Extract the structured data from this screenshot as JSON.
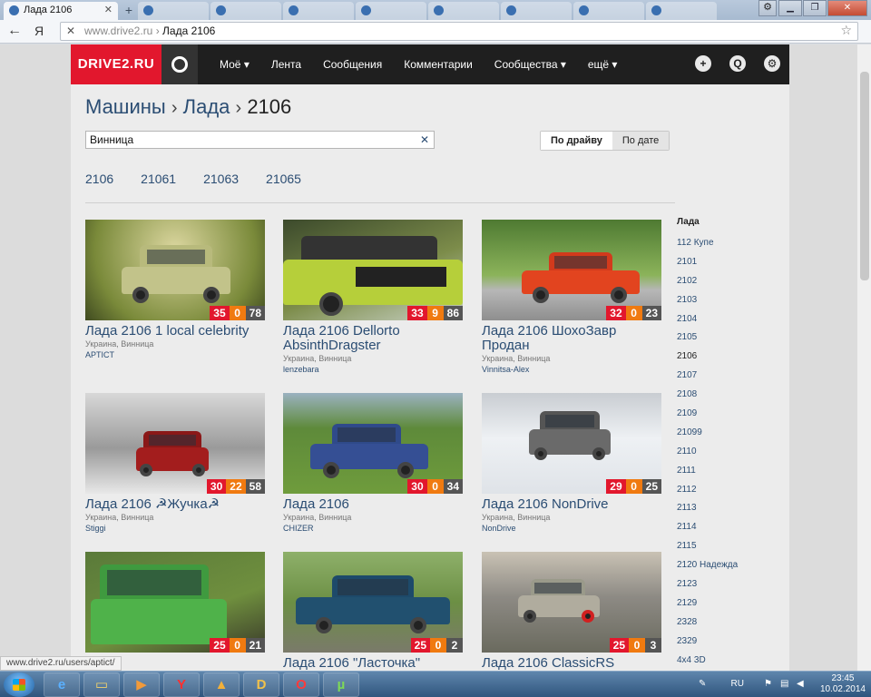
{
  "browser": {
    "tab_title": "Лада 2106",
    "url_host": "www.drive2.ru",
    "url_sep": "›",
    "url_page": "Лада 2106"
  },
  "site": {
    "logo": "DRIVE2.RU",
    "nav": [
      {
        "label": "Моё ▾"
      },
      {
        "label": "Лента"
      },
      {
        "label": "Сообщения"
      },
      {
        "label": "Комментарии"
      },
      {
        "label": "Сообщества ▾"
      },
      {
        "label": "ещё ▾"
      }
    ],
    "breadcrumb": {
      "part1": "Машины",
      "part2": "Лада",
      "current": "2106",
      "sep": "›"
    },
    "search_value": "Винница",
    "sort": {
      "by_drive": "По драйву",
      "by_date": "По дате"
    },
    "models": [
      "2106",
      "21061",
      "21063",
      "21065"
    ]
  },
  "cards": [
    {
      "title": "Лада 2106 1 local celebrity",
      "location": "Украина, Винница",
      "user": "APTICT",
      "s1": "35",
      "s2": "0",
      "s3": "78"
    },
    {
      "title": "Лада 2106 Dellorto AbsinthDragster",
      "location": "Украина, Винница",
      "user": "lenzebara",
      "s1": "33",
      "s2": "9",
      "s3": "86"
    },
    {
      "title": "Лада 2106 ШохоЗавр Продан",
      "location": "Украина, Винница",
      "user": "Vinnitsa-Alex",
      "s1": "32",
      "s2": "0",
      "s3": "23"
    },
    {
      "title": "Лада 2106 ☭Жучка☭",
      "location": "Украина, Винница",
      "user": "Stiggi",
      "s1": "30",
      "s2": "22",
      "s3": "58"
    },
    {
      "title": "Лада 2106",
      "location": "Украина, Винница",
      "user": "CHIZER",
      "s1": "30",
      "s2": "0",
      "s3": "34"
    },
    {
      "title": "Лада 2106 NonDrive",
      "location": "Украина, Винница",
      "user": "NonDrive",
      "s1": "29",
      "s2": "0",
      "s3": "25"
    },
    {
      "title": "",
      "location": "",
      "user": "",
      "s1": "25",
      "s2": "0",
      "s3": "21"
    },
    {
      "title": "Лада 2106 \"Ласточка\"",
      "location": "",
      "user": "",
      "s1": "25",
      "s2": "0",
      "s3": "2"
    },
    {
      "title": "Лада 2106 ClassicRS",
      "location": "",
      "user": "",
      "s1": "25",
      "s2": "0",
      "s3": "3"
    }
  ],
  "sidebar": {
    "heading": "Лада",
    "items": [
      "112 Купе",
      "2101",
      "2102",
      "2103",
      "2104",
      "2105",
      "2106",
      "2107",
      "2108",
      "2109",
      "21099",
      "2110",
      "2111",
      "2112",
      "2113",
      "2114",
      "2115",
      "2120 Надежда",
      "2123",
      "2129",
      "2328",
      "2329",
      "4x4 3D"
    ]
  },
  "status_url": "www.drive2.ru/users/aptict/",
  "taskbar": {
    "lang": "RU",
    "time": "23:45",
    "date": "10.02.2014"
  }
}
